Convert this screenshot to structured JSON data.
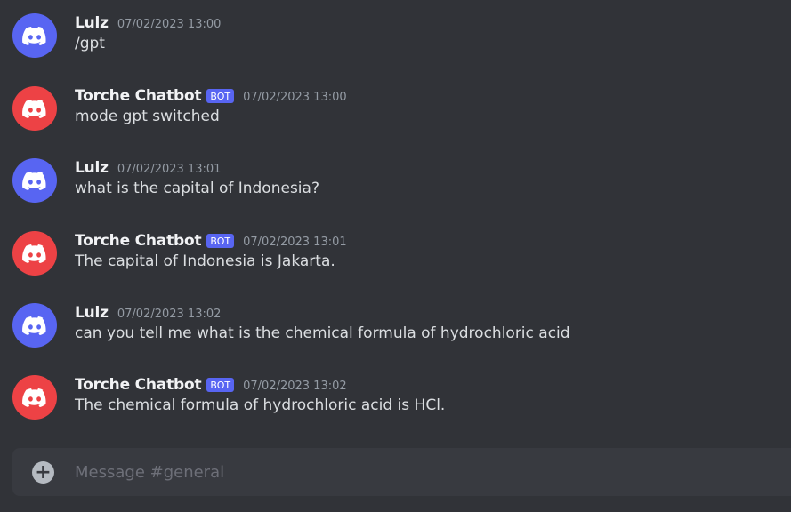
{
  "colors": {
    "background": "#313338",
    "user_avatar": "#5865f2",
    "bot_avatar": "#ed4245",
    "bot_tag": "#5865f2",
    "composer": "#383a40"
  },
  "messages": [
    {
      "author": "Lulz",
      "is_bot": false,
      "avatar_icon": "discord-logo-icon",
      "timestamp": "07/02/2023 13:00",
      "text": "/gpt"
    },
    {
      "author": "Torche Chatbot",
      "is_bot": true,
      "bot_tag": "BOT",
      "avatar_icon": "discord-logo-icon",
      "timestamp": "07/02/2023 13:00",
      "text": "mode gpt switched"
    },
    {
      "author": "Lulz",
      "is_bot": false,
      "avatar_icon": "discord-logo-icon",
      "timestamp": "07/02/2023 13:01",
      "text": "what is the capital of Indonesia?"
    },
    {
      "author": "Torche Chatbot",
      "is_bot": true,
      "bot_tag": "BOT",
      "avatar_icon": "discord-logo-icon",
      "timestamp": "07/02/2023 13:01",
      "text": "The capital of Indonesia is Jakarta."
    },
    {
      "author": "Lulz",
      "is_bot": false,
      "avatar_icon": "discord-logo-icon",
      "timestamp": "07/02/2023 13:02",
      "text": "can you tell me what is the chemical formula of hydrochloric acid"
    },
    {
      "author": "Torche Chatbot",
      "is_bot": true,
      "bot_tag": "BOT",
      "avatar_icon": "discord-logo-icon",
      "timestamp": "07/02/2023 13:02",
      "text": "The chemical formula of hydrochloric acid is HCl."
    }
  ],
  "composer": {
    "attach_icon": "plus-circle-icon",
    "attach_symbol": "+",
    "placeholder": "Message #general",
    "value": ""
  }
}
